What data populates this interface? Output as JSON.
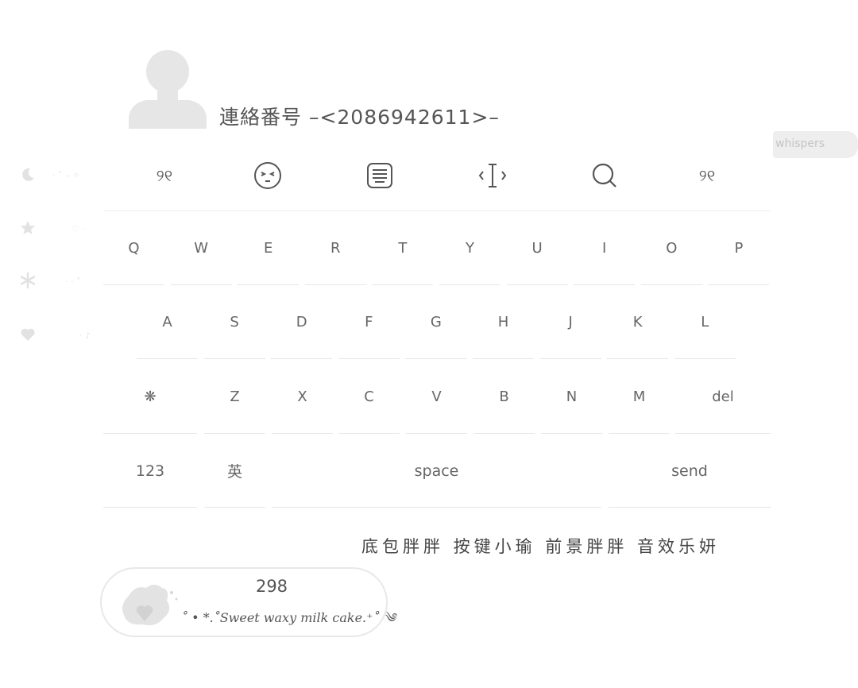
{
  "header": {
    "title": "連絡番号 –<2086942611>–",
    "whispers_label": "whispers"
  },
  "side_menu": {
    "items": [
      {
        "icon": "moon-icon",
        "label": "· ˚ ₊ ✧"
      },
      {
        "icon": "star-icon",
        "label": "♡ ·"
      },
      {
        "icon": "snowflake-icon",
        "label": "· · ˚"
      },
      {
        "icon": "heart-icon",
        "label": "· ♪"
      }
    ]
  },
  "toolbar": {
    "items": [
      {
        "icon": "quote-icon",
        "glyph": "୨୧"
      },
      {
        "icon": "emoji-face-icon",
        "glyph": ""
      },
      {
        "icon": "keyboard-icon",
        "glyph": ""
      },
      {
        "icon": "cursor-move-icon",
        "glyph": ""
      },
      {
        "icon": "search-icon",
        "glyph": ""
      },
      {
        "icon": "quote-icon",
        "glyph": "୨୧"
      }
    ]
  },
  "keyboard": {
    "row1": [
      "Q",
      "W",
      "E",
      "R",
      "T",
      "Y",
      "U",
      "I",
      "O",
      "P"
    ],
    "row2": [
      "A",
      "S",
      "D",
      "F",
      "G",
      "H",
      "J",
      "K",
      "L"
    ],
    "row3": [
      "❋",
      "Z",
      "X",
      "C",
      "V",
      "B",
      "N",
      "M",
      "del"
    ],
    "row4": [
      "123",
      "英",
      "space",
      "send"
    ]
  },
  "credits": "底包胖胖 按键小瑜 前景胖胖 音效乐妍",
  "counter": {
    "count": "298",
    "tagline": "˚ • *.˚Sweet waxy milk cake.⁺˚ ༄"
  },
  "colors": {
    "background": "#ffffff",
    "text": "#555555",
    "divider": "#e6e6e6",
    "muted": "#e2e2e2"
  }
}
